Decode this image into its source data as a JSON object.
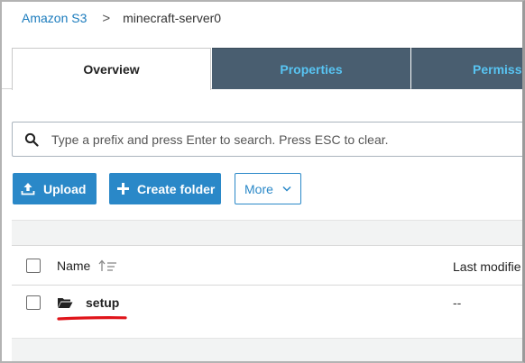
{
  "breadcrumb": {
    "root": "Amazon S3",
    "separator": ">",
    "current": "minecraft-server0"
  },
  "tabs": [
    {
      "label": "Overview",
      "active": true
    },
    {
      "label": "Properties",
      "active": false
    },
    {
      "label": "Permissi",
      "active": false
    }
  ],
  "search": {
    "placeholder": "Type a prefix and press Enter to search. Press ESC to clear.",
    "value": "",
    "icon": "search-icon"
  },
  "toolbar": {
    "upload_label": "Upload",
    "create_folder_label": "Create folder",
    "more_label": "More"
  },
  "table": {
    "columns": {
      "name": "Name",
      "last_modified": "Last modifie"
    },
    "rows": [
      {
        "name": "setup",
        "last_modified": "--",
        "type": "folder"
      }
    ]
  },
  "colors": {
    "accent": "#2a88c8",
    "link": "#1a7bbd",
    "tab_dark_bg": "#495e70",
    "tab_dark_text": "#58c4f2",
    "annotation": "#e0141a"
  }
}
